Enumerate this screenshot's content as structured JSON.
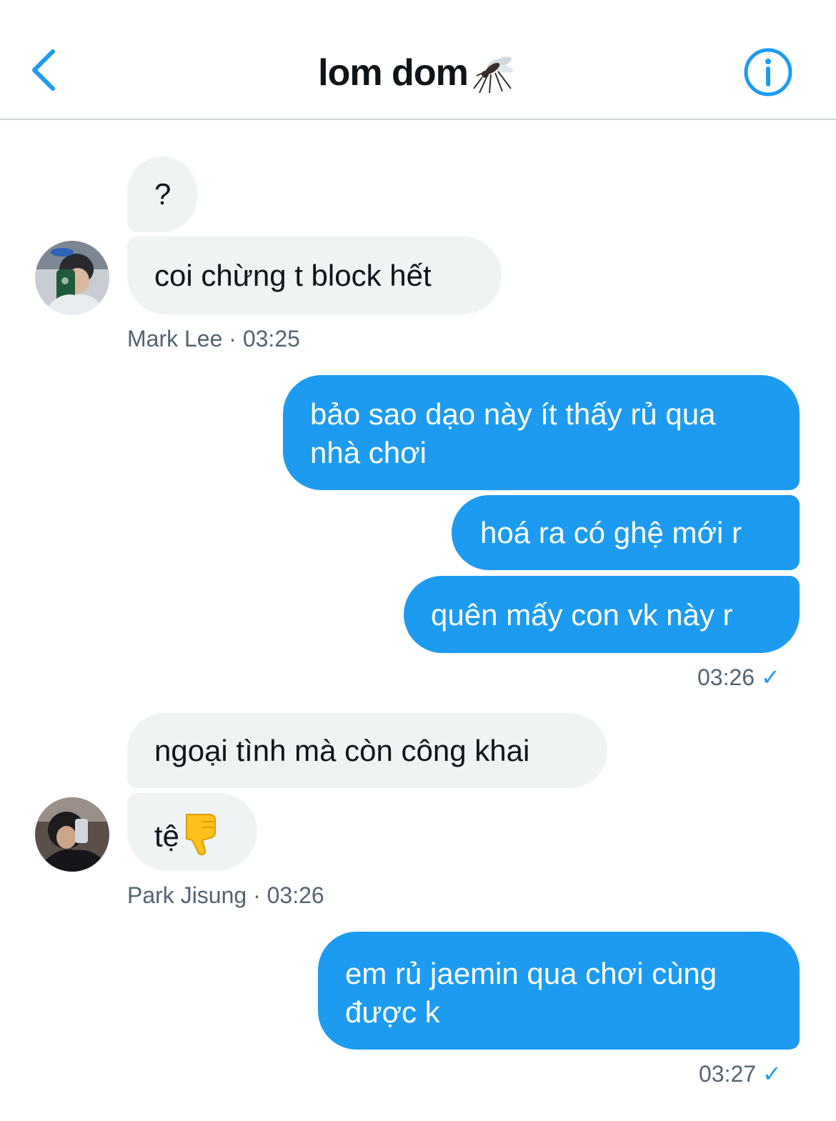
{
  "header": {
    "title": "lom dom",
    "title_emoji": "mosquito-icon",
    "back_icon": "chevron-left-icon",
    "info_icon": "info-circle-icon"
  },
  "colors": {
    "accent": "#1d9bf0",
    "incoming_bubble": "#eff3f4",
    "meta_text": "#536471"
  },
  "messages": {
    "group1": {
      "sender": "Mark Lee",
      "meta": "Mark Lee · 03:25",
      "msg1": "?",
      "msg2": "coi chừng t block hết"
    },
    "group2": {
      "msg1_line1": "bảo sao dạo này ít thấy rủ qua",
      "msg1_line2": "nhà chơi",
      "msg2": "hoá ra có ghệ mới r",
      "msg3": "quên mấy con vk này r",
      "time": "03:26"
    },
    "group3": {
      "sender": "Park Jisung",
      "meta": "Park Jisung · 03:26",
      "msg1": "ngoại tình mà còn công khai",
      "msg2": "tệ",
      "msg2_emoji": "thumbs-down-icon"
    },
    "group4": {
      "msg1_line1": "em rủ jaemin qua chơi cùng",
      "msg1_line2": "được k",
      "time": "03:27"
    }
  }
}
